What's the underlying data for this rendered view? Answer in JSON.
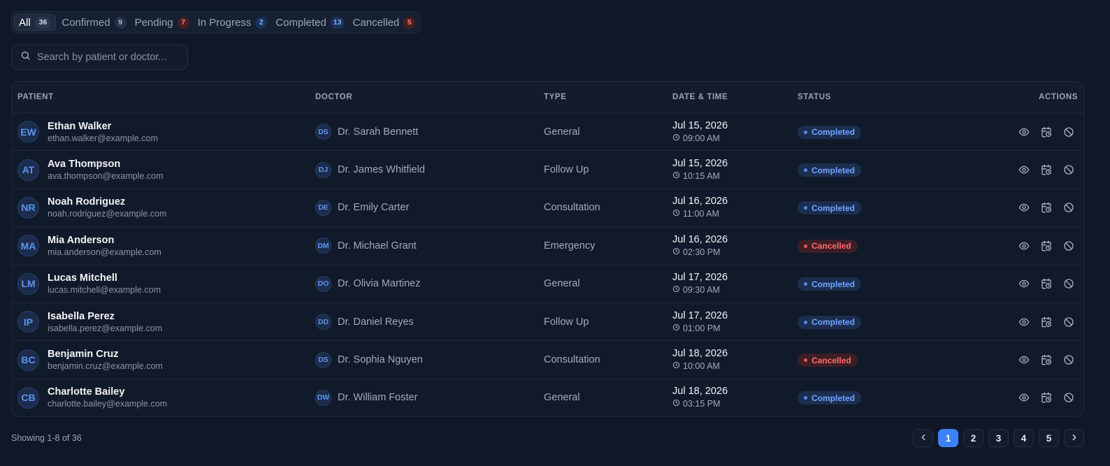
{
  "tabs": [
    {
      "label": "All",
      "count": "36",
      "active": true,
      "tone": "neutral"
    },
    {
      "label": "Confirmed",
      "count": "9",
      "active": false,
      "tone": "neutral"
    },
    {
      "label": "Pending",
      "count": "7",
      "active": false,
      "tone": "danger"
    },
    {
      "label": "In Progress",
      "count": "2",
      "active": false,
      "tone": "info"
    },
    {
      "label": "Completed",
      "count": "13",
      "active": false,
      "tone": "info"
    },
    {
      "label": "Cancelled",
      "count": "5",
      "active": false,
      "tone": "danger"
    }
  ],
  "search": {
    "placeholder": "Search by patient or doctor...",
    "icon": "search-icon"
  },
  "table": {
    "headers": {
      "patient": "PATIENT",
      "doctor": "DOCTOR",
      "type": "TYPE",
      "date": "DATE & TIME",
      "status": "STATUS",
      "actions": "ACTIONS"
    },
    "rows": [
      {
        "initials": "EW",
        "name": "Ethan Walker",
        "email": "ethan.walker@example.com",
        "doctor_initials": "DS",
        "doctor": "Dr. Sarah Bennett",
        "type": "General",
        "date": "Jul 15, 2026",
        "time": "09:00 AM",
        "status": "Completed"
      },
      {
        "initials": "AT",
        "name": "Ava Thompson",
        "email": "ava.thompson@example.com",
        "doctor_initials": "DJ",
        "doctor": "Dr. James Whitfield",
        "type": "Follow Up",
        "date": "Jul 15, 2026",
        "time": "10:15 AM",
        "status": "Completed"
      },
      {
        "initials": "NR",
        "name": "Noah Rodriguez",
        "email": "noah.rodriguez@example.com",
        "doctor_initials": "DE",
        "doctor": "Dr. Emily Carter",
        "type": "Consultation",
        "date": "Jul 16, 2026",
        "time": "11:00 AM",
        "status": "Completed"
      },
      {
        "initials": "MA",
        "name": "Mia Anderson",
        "email": "mia.anderson@example.com",
        "doctor_initials": "DM",
        "doctor": "Dr. Michael Grant",
        "type": "Emergency",
        "date": "Jul 16, 2026",
        "time": "02:30 PM",
        "status": "Cancelled"
      },
      {
        "initials": "LM",
        "name": "Lucas Mitchell",
        "email": "lucas.mitchell@example.com",
        "doctor_initials": "DO",
        "doctor": "Dr. Olivia Martinez",
        "type": "General",
        "date": "Jul 17, 2026",
        "time": "09:30 AM",
        "status": "Completed"
      },
      {
        "initials": "IP",
        "name": "Isabella Perez",
        "email": "isabella.perez@example.com",
        "doctor_initials": "DD",
        "doctor": "Dr. Daniel Reyes",
        "type": "Follow Up",
        "date": "Jul 17, 2026",
        "time": "01:00 PM",
        "status": "Completed"
      },
      {
        "initials": "BC",
        "name": "Benjamin Cruz",
        "email": "benjamin.cruz@example.com",
        "doctor_initials": "DS",
        "doctor": "Dr. Sophia Nguyen",
        "type": "Consultation",
        "date": "Jul 18, 2026",
        "time": "10:00 AM",
        "status": "Cancelled"
      },
      {
        "initials": "CB",
        "name": "Charlotte Bailey",
        "email": "charlotte.bailey@example.com",
        "doctor_initials": "DW",
        "doctor": "Dr. William Foster",
        "type": "General",
        "date": "Jul 18, 2026",
        "time": "03:15 PM",
        "status": "Completed"
      }
    ],
    "action_icons": [
      "eye-icon",
      "calendar-clock-icon",
      "cancel-icon"
    ]
  },
  "footer": {
    "showing": "Showing 1-8 of 36",
    "pages": [
      "1",
      "2",
      "3",
      "4",
      "5"
    ],
    "current_page": "1",
    "prev_icon": "chevron-left-icon",
    "next_icon": "chevron-right-icon"
  },
  "colors": {
    "background": "#101828",
    "accent": "#3b82f6",
    "completed": "#6fa6ff",
    "cancelled": "#ff6b6b"
  }
}
